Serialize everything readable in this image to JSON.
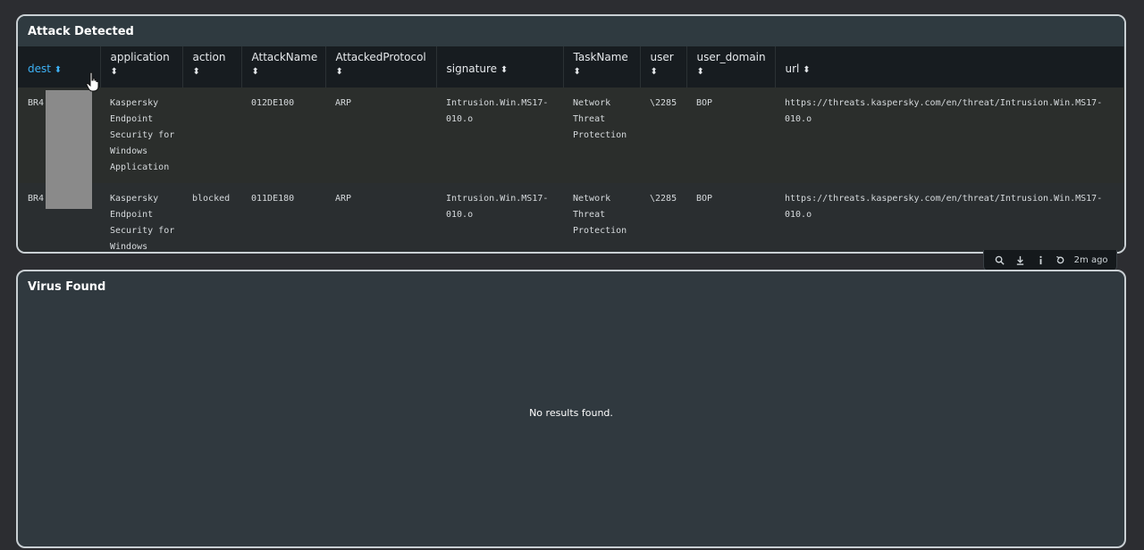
{
  "attack_panel": {
    "title": "Attack Detected",
    "columns": [
      {
        "label": "dest",
        "sort_icon": "sort-icon",
        "active": true
      },
      {
        "label": "application",
        "sort_icon": "sort-icon"
      },
      {
        "label": "action",
        "sort_icon": "sort-icon"
      },
      {
        "label": "AttackName",
        "sort_icon": "sort-icon"
      },
      {
        "label": "AttackedProtocol",
        "sort_icon": "sort-icon"
      },
      {
        "label": "signature",
        "sort_icon": "sort-icon"
      },
      {
        "label": "TaskName",
        "sort_icon": "sort-icon"
      },
      {
        "label": "user",
        "sort_icon": "sort-icon"
      },
      {
        "label": "user_domain",
        "sort_icon": "sort-icon"
      },
      {
        "label": "url",
        "sort_icon": "sort-icon"
      }
    ],
    "sort_glyph": "⬍",
    "rows": [
      {
        "dest": "BR4",
        "application": "Kaspersky Endpoint Security for Windows Application",
        "action": "",
        "AttackName": "012DE100",
        "AttackedProtocol": "ARP",
        "signature": "Intrusion.Win.MS17-010.o",
        "TaskName": "Network Threat Protection",
        "user": "\\2285",
        "user_domain": "BOP",
        "url": "https://threats.kaspersky.com/en/threat/Intrusion.Win.MS17-010.o"
      },
      {
        "dest": "BR4",
        "application": "Kaspersky Endpoint Security for Windows",
        "action": "blocked",
        "AttackName": "011DE180",
        "AttackedProtocol": "ARP",
        "signature": "Intrusion.Win.MS17-010.o",
        "TaskName": "Network Threat Protection",
        "user": "\\2285",
        "user_domain": "BOP",
        "url": "https://threats.kaspersky.com/en/threat/Intrusion.Win.MS17-010.o"
      }
    ]
  },
  "toolbar": {
    "icons": [
      "search-icon",
      "download-icon",
      "info-icon",
      "refresh-icon"
    ],
    "time_label": "2m ago"
  },
  "virus_panel": {
    "title": "Virus Found",
    "empty_message": "No results found."
  },
  "colors": {
    "background": "#2c2d31",
    "panel": "#2b3033",
    "header": "#171c20",
    "accent": "#3db1f5",
    "border": "#c9cfd3"
  }
}
